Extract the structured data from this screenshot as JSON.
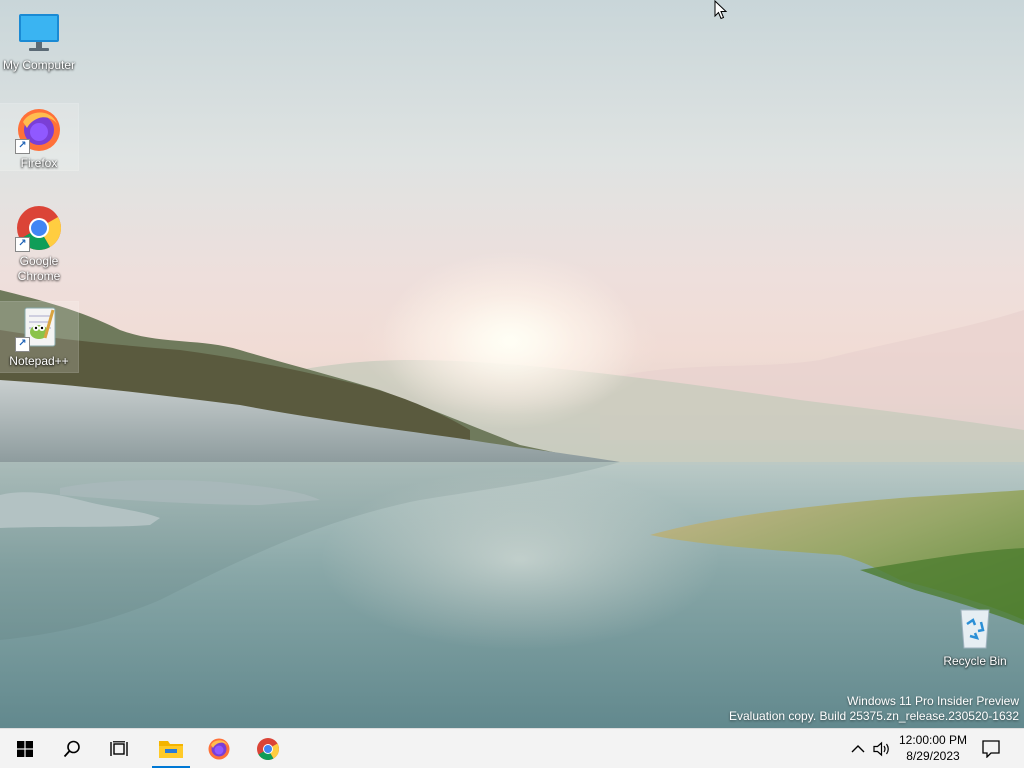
{
  "desktop": {
    "icons": [
      {
        "label": "My Computer",
        "icon": "monitor-icon"
      },
      {
        "label": "Firefox",
        "icon": "firefox-icon",
        "shortcut": true
      },
      {
        "label": "Google Chrome",
        "icon": "chrome-icon",
        "shortcut": true
      },
      {
        "label": "Notepad++",
        "icon": "notepad-plus-plus-icon",
        "shortcut": true
      },
      {
        "label": "Recycle Bin",
        "icon": "recycle-bin-icon"
      }
    ],
    "watermark": {
      "line1": "Windows 11 Pro Insider Preview",
      "line2": "Evaluation copy. Build 25375.zn_release.230520-1632"
    }
  },
  "taskbar": {
    "buttons": [
      {
        "name": "start",
        "icon": "windows-logo-icon"
      },
      {
        "name": "search",
        "icon": "search-icon"
      },
      {
        "name": "task-view",
        "icon": "task-view-icon"
      },
      {
        "name": "file-explorer",
        "icon": "folder-icon",
        "active": true
      },
      {
        "name": "firefox",
        "icon": "firefox-icon"
      },
      {
        "name": "chrome",
        "icon": "chrome-icon"
      }
    ],
    "tray": {
      "time": "12:00:00 PM",
      "date": "8/29/2023",
      "icons": [
        "chevron-up-icon",
        "speaker-icon",
        "notification-icon"
      ]
    }
  },
  "colors": {
    "accent": "#0078d4",
    "taskbar_bg": "#f3f3f3"
  }
}
